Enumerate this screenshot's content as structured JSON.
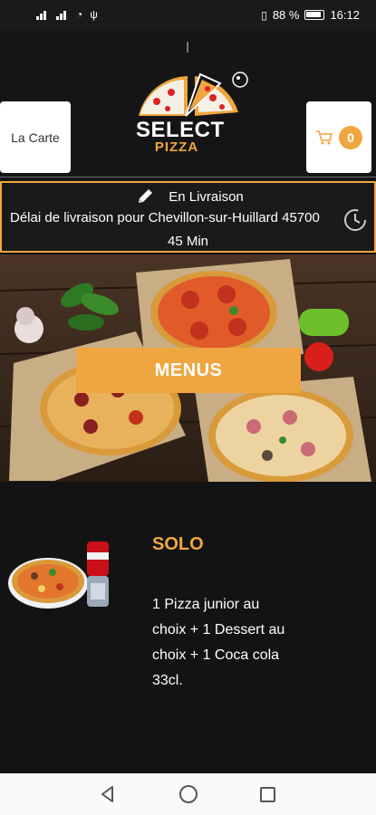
{
  "status_bar": {
    "battery": "88 %",
    "time": "16:12"
  },
  "header": {
    "left_button": "La Carte",
    "logo_line1": "SELECT",
    "logo_line2": "PIZZA",
    "cart_count": "0"
  },
  "delivery": {
    "mode": "En Livraison",
    "info": "Délai de livraison pour Chevillon-sur-Huillard 45700",
    "time": "45 Min"
  },
  "hero": {
    "button_label": "MENUS"
  },
  "product": {
    "title": "SOLO",
    "description": "1 Pizza junior au choix + 1 Dessert au choix + 1 Coca cola 33cl."
  },
  "colors": {
    "accent": "#f0a640",
    "background": "#161616"
  }
}
